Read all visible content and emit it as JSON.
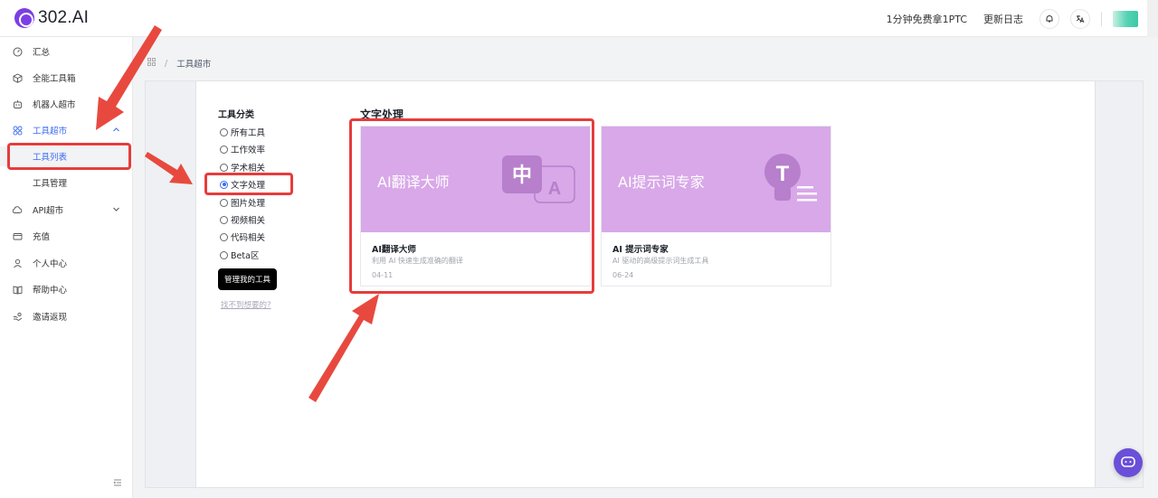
{
  "header": {
    "logo_text": "302.AI",
    "free_trial_label": "1分钟免费拿1PTC",
    "changelog_label": "更新日志"
  },
  "sidebar": {
    "items": [
      {
        "label": "汇总",
        "icon": "dashboard-icon"
      },
      {
        "label": "全能工具箱",
        "icon": "cube-icon"
      },
      {
        "label": "机器人超市",
        "icon": "robot-icon"
      },
      {
        "label": "工具超市",
        "icon": "grid-icon"
      },
      {
        "label": "工具列表"
      },
      {
        "label": "工具管理"
      },
      {
        "label": "API超市",
        "icon": "cloud-icon"
      },
      {
        "label": "充值",
        "icon": "wallet-icon"
      },
      {
        "label": "个人中心",
        "icon": "user-icon"
      },
      {
        "label": "帮助中心",
        "icon": "book-icon"
      },
      {
        "label": "邀请返现",
        "icon": "gift-icon"
      }
    ]
  },
  "breadcrumb": {
    "home_icon": "grid-small-icon",
    "separator": "/",
    "current": "工具超市"
  },
  "categories": {
    "title": "工具分类",
    "options": [
      "所有工具",
      "工作效率",
      "学术相关",
      "文字处理",
      "图片处理",
      "视频相关",
      "代码相关",
      "Beta区"
    ],
    "selected": "文字处理",
    "manage_button": "管理我的工具",
    "not_found_link": "找不到想要的?"
  },
  "section": {
    "title": "文字处理"
  },
  "cards": [
    {
      "banner_title": "AI翻译大师",
      "name": "AI翻译大师",
      "desc": "利用 AI 快速生成准确的翻译",
      "date": "04-11",
      "glyph_zh": "中",
      "glyph_a": "A"
    },
    {
      "banner_title": "AI提示词专家",
      "name": "AI 提示词专家",
      "desc": "AI 驱动的高级提示词生成工具",
      "date": "06-24",
      "glyph_t": "T"
    }
  ],
  "colors": {
    "accent": "#3c6cf0",
    "card_banner": "#d8a8e8",
    "highlight": "#e63c3c",
    "brand": "#7b3fe4"
  }
}
